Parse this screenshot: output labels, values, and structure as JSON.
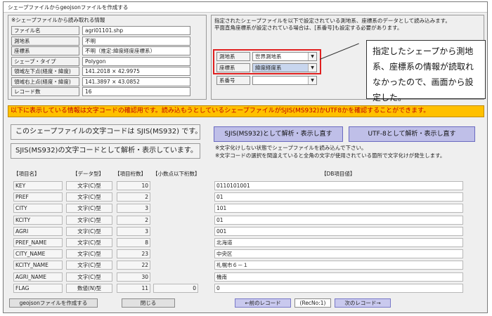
{
  "window": {
    "title": "シェープファイルからgeojsonファイルを作成する"
  },
  "info_panel": {
    "heading": "※シェープファイルから読み取れる情報",
    "rows": [
      {
        "label": "ファイル名",
        "value": "agri01101.shp"
      },
      {
        "label": "測地系",
        "value": "不明"
      },
      {
        "label": "座標系",
        "value": "不明（推定:緯度経度座標系）"
      },
      {
        "label": "シェープ・タイプ",
        "value": "Polygon"
      },
      {
        "label": "領域左下点(経度・緯度)",
        "value": "141.2018 × 42.9975"
      },
      {
        "label": "領域右上点(経度・緯度)",
        "value": "141.3897 × 43.0852"
      },
      {
        "label": "レコード数",
        "value": "16"
      }
    ]
  },
  "settings_panel": {
    "desc_line1": "指定されたシェープファイルを以下で設定されている測地系、座標系のデータとして読み込みます。",
    "desc_line2": "平面直角座標系が設定されている場合は、[系番号]も設定する必要があります。",
    "datum_label": "測地系",
    "datum_value": "世界測地系",
    "coord_label": "座標系",
    "coord_value": "緯度経度系",
    "zone_label": "系番号",
    "zone_value": ""
  },
  "callout": {
    "text": "指定したシェープから測地系、座標系の情報が読取れなかったので、画面から設定した。"
  },
  "banner": {
    "text": "以下に表示している情報は文字コードの確認用です。読み込もうとしているシェープファイルがSJIS(MS932)かUTF8かを確認することができます。"
  },
  "encoding": {
    "status_line1": "このシェープファイルの文字コードは SJIS(MS932) です。",
    "status_line2": "SJIS(MS932)の文字コードとして解析・表示しています。",
    "btn_sjis": "SJIS(MS932)として解析・表示し直す",
    "btn_utf8": "UTF-8として解析・表示し直す",
    "note1": "※文字化けしない状態でシェープファイルを読み込んで下さい。",
    "note2": "※文字コードの選択を間違えていると全角の文字が使用されている箇所で文字化けが発生します。"
  },
  "table": {
    "headers": [
      "【項目名】",
      "【データ型】",
      "【項目桁数】",
      "【小数点以下桁数】",
      "【DB項目値】"
    ],
    "rows": [
      {
        "name": "KEY",
        "type": "文字(C)型",
        "digits": "10",
        "decimals": "",
        "value": "0110101001"
      },
      {
        "name": "PREF",
        "type": "文字(C)型",
        "digits": "2",
        "decimals": "",
        "value": "01"
      },
      {
        "name": "CITY",
        "type": "文字(C)型",
        "digits": "3",
        "decimals": "",
        "value": "101"
      },
      {
        "name": "KCITY",
        "type": "文字(C)型",
        "digits": "2",
        "decimals": "",
        "value": "01"
      },
      {
        "name": "AGRI",
        "type": "文字(C)型",
        "digits": "3",
        "decimals": "",
        "value": "001"
      },
      {
        "name": "PREF_NAME",
        "type": "文字(C)型",
        "digits": "8",
        "decimals": "",
        "value": "北海道"
      },
      {
        "name": "CITY_NAME",
        "type": "文字(C)型",
        "digits": "23",
        "decimals": "",
        "value": "中央区"
      },
      {
        "name": "KCITY_NAME",
        "type": "文字(C)型",
        "digits": "22",
        "decimals": "",
        "value": "札幌市６－１"
      },
      {
        "name": "AGRI_NAME",
        "type": "文字(C)型",
        "digits": "30",
        "decimals": "",
        "value": "機南"
      },
      {
        "name": "FLAG",
        "type": "数値(N)型",
        "digits": "11",
        "decimals": "0",
        "value": "0"
      }
    ]
  },
  "footer": {
    "create_btn": "geojsonファイルを作成する",
    "close_btn": "閉じる",
    "prev_btn": "←前のレコード",
    "recno": "(RecNo:1)",
    "next_btn": "次のレコード→"
  }
}
